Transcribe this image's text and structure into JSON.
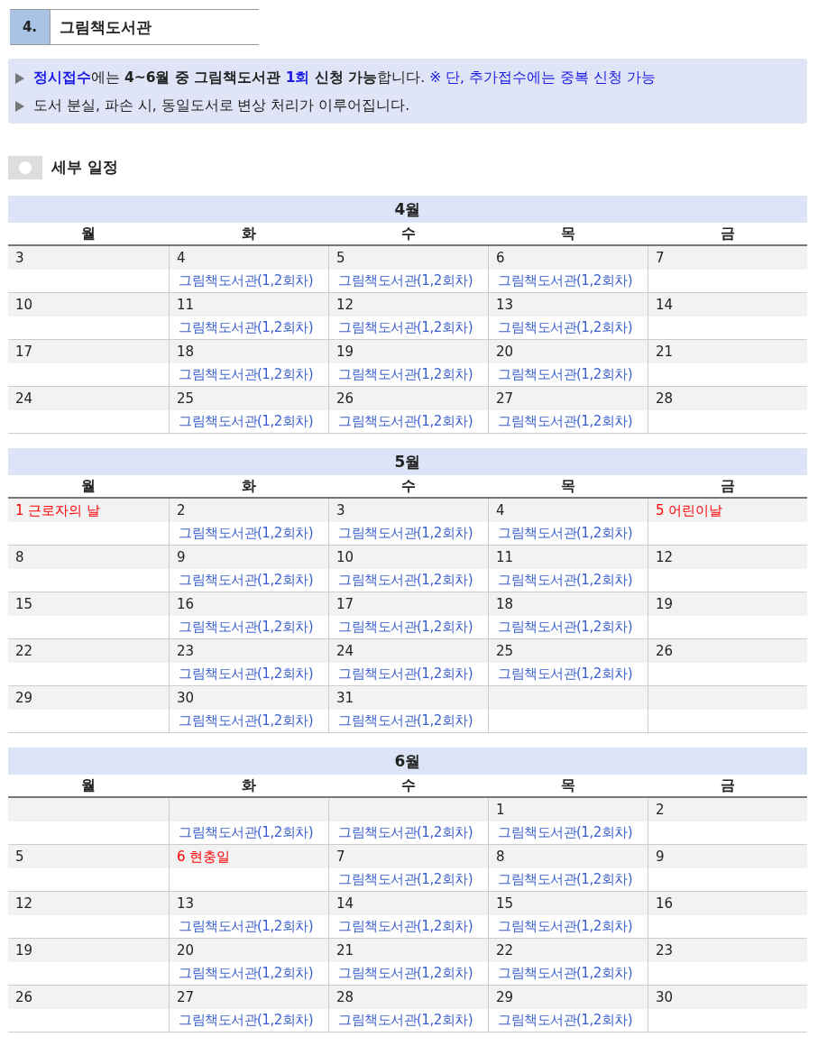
{
  "section": {
    "number": "4.",
    "title": "그림책도서관"
  },
  "notices": [
    {
      "parts": [
        {
          "text": "정시접수",
          "kind": "key"
        },
        {
          "text": "에는 ",
          "kind": "plain"
        },
        {
          "text": "4~6월 중 그림책도서관",
          "kind": "strong"
        },
        {
          "text": " 1회",
          "kind": "key"
        },
        {
          "text": " 신청 가능",
          "kind": "strong"
        },
        {
          "text": "합니다.",
          "kind": "plain"
        },
        {
          "text": " ※ 단, 추가접수에는 중복 신청 가능",
          "kind": "note"
        }
      ]
    },
    {
      "parts": [
        {
          "text": "도서 분실, 파손 시, 동일도서로 변상 처리가 이루어집니다.",
          "kind": "plain"
        }
      ]
    }
  ],
  "subheading": "세부 일정",
  "months": [
    {
      "title": "4월",
      "weekdays": [
        "월",
        "화",
        "수",
        "목",
        "금"
      ],
      "weeks": [
        [
          {
            "day": "3",
            "holiday": false
          },
          {
            "day": "4",
            "holiday": false,
            "event": {
              "lead": "그림책",
              "text": "도서관(1,2회차)"
            }
          },
          {
            "day": "5",
            "holiday": false,
            "event": {
              "lead": "그림책",
              "text": "도서관(1,2회차)"
            }
          },
          {
            "day": "6",
            "holiday": false,
            "event": {
              "lead": "그림책",
              "text": "도서관(1,2회차)"
            }
          },
          {
            "day": "7",
            "holiday": false
          }
        ],
        [
          {
            "day": "10",
            "holiday": false
          },
          {
            "day": "11",
            "holiday": false,
            "event": {
              "lead": "그림책",
              "text": "도서관(1,2회차)"
            }
          },
          {
            "day": "12",
            "holiday": false,
            "event": {
              "lead": "그림책",
              "text": "도서관(1,2회차)"
            }
          },
          {
            "day": "13",
            "holiday": false,
            "event": {
              "lead": "그림책",
              "text": "도서관(1,2회차)"
            }
          },
          {
            "day": "14",
            "holiday": false
          }
        ],
        [
          {
            "day": "17",
            "holiday": false
          },
          {
            "day": "18",
            "holiday": false,
            "event": {
              "lead": "그림책",
              "text": "도서관(1,2회차)"
            }
          },
          {
            "day": "19",
            "holiday": false,
            "event": {
              "lead": "그림책",
              "text": "도서관(1,2회차)"
            }
          },
          {
            "day": "20",
            "holiday": false,
            "event": {
              "lead": "그림책",
              "text": "도서관(1,2회차)"
            }
          },
          {
            "day": "21",
            "holiday": false
          }
        ],
        [
          {
            "day": "24",
            "holiday": false
          },
          {
            "day": "25",
            "holiday": false,
            "event": {
              "lead": "그림책",
              "text": "도서관(1,2회차)"
            }
          },
          {
            "day": "26",
            "holiday": false,
            "event": {
              "lead": "그림책",
              "text": "도서관(1,2회차)"
            }
          },
          {
            "day": "27",
            "holiday": false,
            "event": {
              "lead": "그림책",
              "text": "도서관(1,2회차)"
            }
          },
          {
            "day": "28",
            "holiday": false
          }
        ]
      ]
    },
    {
      "title": "5월",
      "weekdays": [
        "월",
        "화",
        "수",
        "목",
        "금"
      ],
      "weeks": [
        [
          {
            "day": "1 근로자의 날",
            "holiday": true
          },
          {
            "day": "2",
            "holiday": false,
            "event": {
              "lead": "그림책",
              "text": "도서관(1,2회차)"
            }
          },
          {
            "day": "3",
            "holiday": false,
            "event": {
              "lead": "그림책",
              "text": "도서관(1,2회차)"
            }
          },
          {
            "day": "4",
            "holiday": false,
            "event": {
              "lead": "그림책",
              "text": "도서관(1,2회차)"
            }
          },
          {
            "day": "5 어린이날",
            "holiday": true
          }
        ],
        [
          {
            "day": "8",
            "holiday": false
          },
          {
            "day": "9",
            "holiday": false,
            "event": {
              "lead": "그림책",
              "text": "도서관(1,2회차)"
            }
          },
          {
            "day": "10",
            "holiday": false,
            "event": {
              "lead": "그림책",
              "text": "도서관(1,2회차)"
            }
          },
          {
            "day": "11",
            "holiday": false,
            "event": {
              "lead": "그림책",
              "text": "도서관(1,2회차)"
            }
          },
          {
            "day": "12",
            "holiday": false
          }
        ],
        [
          {
            "day": "15",
            "holiday": false
          },
          {
            "day": "16",
            "holiday": false,
            "event": {
              "lead": "그림책",
              "text": "도서관(1,2회차)"
            }
          },
          {
            "day": "17",
            "holiday": false,
            "event": {
              "lead": "그림책",
              "text": "도서관(1,2회차)"
            }
          },
          {
            "day": "18",
            "holiday": false,
            "event": {
              "lead": "그림책",
              "text": "도서관(1,2회차)"
            }
          },
          {
            "day": "19",
            "holiday": false
          }
        ],
        [
          {
            "day": "22",
            "holiday": false
          },
          {
            "day": "23",
            "holiday": false,
            "event": {
              "lead": "그림책",
              "text": "도서관(1,2회차)"
            }
          },
          {
            "day": "24",
            "holiday": false,
            "event": {
              "lead": "그림책",
              "text": "도서관(1,2회차)"
            }
          },
          {
            "day": "25",
            "holiday": false,
            "event": {
              "lead": "그림책",
              "text": "도서관(1,2회차)"
            }
          },
          {
            "day": "26",
            "holiday": false
          }
        ],
        [
          {
            "day": "29",
            "holiday": false
          },
          {
            "day": "30",
            "holiday": false,
            "event": {
              "lead": "그림책",
              "text": "도서관(1,2회차)"
            }
          },
          {
            "day": "31",
            "holiday": false,
            "event": {
              "lead": "그림책",
              "text": "도서관(1,2회차)"
            }
          },
          {
            "kind": "blank"
          },
          {
            "kind": "blank"
          }
        ]
      ]
    },
    {
      "title": "6월",
      "weekdays": [
        "월",
        "화",
        "수",
        "목",
        "금"
      ],
      "weeks": [
        [
          {
            "kind": "blank"
          },
          {
            "kind": "blank",
            "event": {
              "lead": "그림책",
              "text": "도서관(1,2회차)"
            }
          },
          {
            "kind": "blank",
            "event": {
              "lead": "그림책",
              "text": "도서관(1,2회차)"
            }
          },
          {
            "day": "1",
            "holiday": false,
            "event": {
              "lead": "그림책",
              "text": "도서관(1,2회차)"
            }
          },
          {
            "day": "2",
            "holiday": false
          }
        ],
        [
          {
            "day": "5",
            "holiday": false
          },
          {
            "day": "6 현충일",
            "holiday": true
          },
          {
            "day": "7",
            "holiday": false,
            "event": {
              "lead": "그림책",
              "text": "도서관(1,2회차)"
            }
          },
          {
            "day": "8",
            "holiday": false,
            "event": {
              "lead": "그림책",
              "text": "도서관(1,2회차)"
            }
          },
          {
            "day": "9",
            "holiday": false
          }
        ],
        [
          {
            "day": "12",
            "holiday": false
          },
          {
            "day": "13",
            "holiday": false,
            "event": {
              "lead": "그림책",
              "text": "도서관(1,2회차)"
            }
          },
          {
            "day": "14",
            "holiday": false,
            "event": {
              "lead": "그림책",
              "text": "도서관(1,2회차)"
            }
          },
          {
            "day": "15",
            "holiday": false,
            "event": {
              "lead": "그림책",
              "text": "도서관(1,2회차)"
            }
          },
          {
            "day": "16",
            "holiday": false
          }
        ],
        [
          {
            "day": "19",
            "holiday": false
          },
          {
            "day": "20",
            "holiday": false,
            "event": {
              "lead": "그림책",
              "text": "도서관(1,2회차)"
            }
          },
          {
            "day": "21",
            "holiday": false,
            "event": {
              "lead": "그림책",
              "text": "도서관(1,2회차)"
            }
          },
          {
            "day": "22",
            "holiday": false,
            "event": {
              "lead": "그림책",
              "text": "도서관(1,2회차)"
            }
          },
          {
            "day": "23",
            "holiday": false
          }
        ],
        [
          {
            "day": "26",
            "holiday": false
          },
          {
            "day": "27",
            "holiday": false,
            "event": {
              "lead": "그림책",
              "text": "도서관(1,2회차)"
            }
          },
          {
            "day": "28",
            "holiday": false,
            "event": {
              "lead": "그림책",
              "text": "도서관(1,2회차)"
            }
          },
          {
            "day": "29",
            "holiday": false,
            "event": {
              "lead": "그림책",
              "text": "도서관(1,2회차)"
            }
          },
          {
            "day": "30",
            "holiday": false
          }
        ]
      ]
    }
  ]
}
